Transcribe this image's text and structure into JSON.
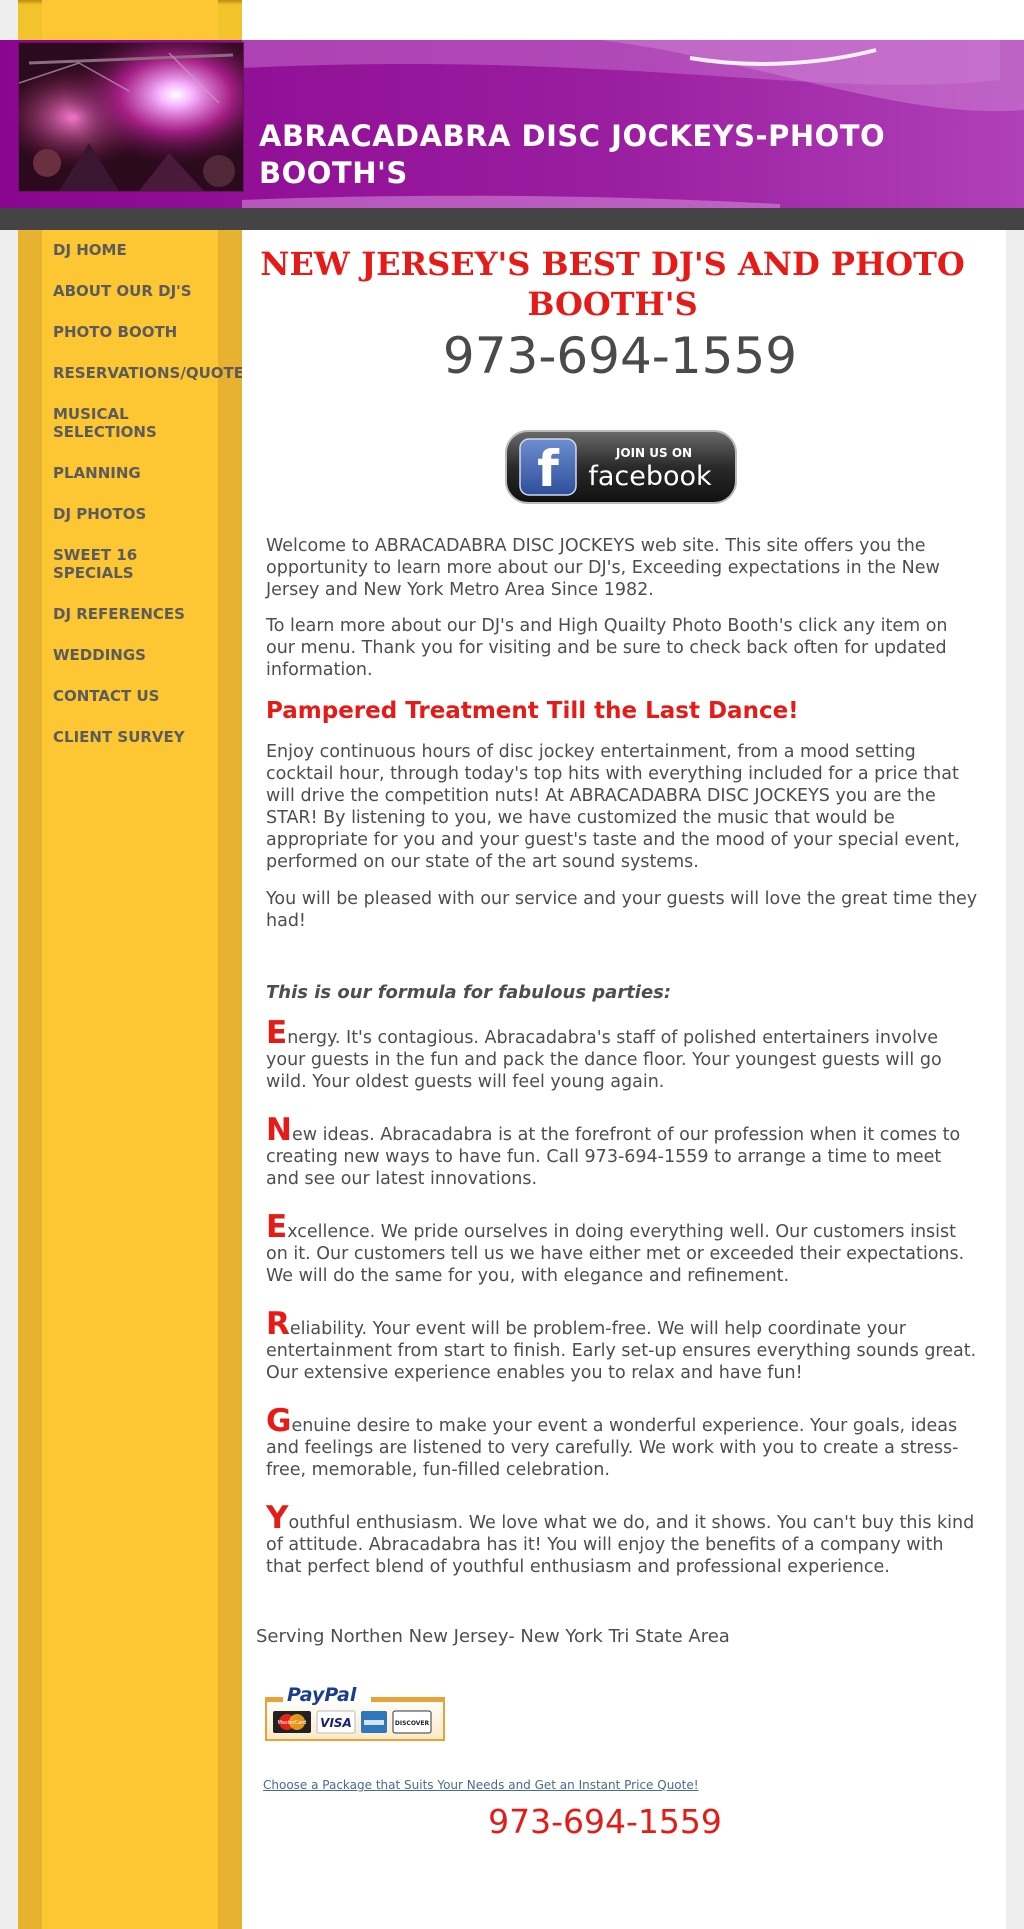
{
  "header": {
    "title": "ABRACADABRA DISC JOCKEYS-PHOTO BOOTH'S"
  },
  "sidebar": {
    "items": [
      {
        "label": "DJ HOME"
      },
      {
        "label": "ABOUT OUR DJ'S"
      },
      {
        "label": "PHOTO BOOTH"
      },
      {
        "label": "RESERVATIONS/QUOTE"
      },
      {
        "label": "MUSICAL SELECTIONS"
      },
      {
        "label": "PLANNING"
      },
      {
        "label": "DJ PHOTOS"
      },
      {
        "label": "SWEET 16 SPECIALS"
      },
      {
        "label": "DJ REFERENCES"
      },
      {
        "label": "WEDDINGS"
      },
      {
        "label": "CONTACT US"
      },
      {
        "label": "CLIENT SURVEY"
      }
    ]
  },
  "main": {
    "heading": "NEW JERSEY'S BEST DJ'S AND PHOTO BOOTH'S",
    "phone": "973-694-1559",
    "facebook": {
      "line1": "JOIN US ON",
      "line2": "facebook",
      "logo_letter": "f"
    },
    "intro": [
      "Welcome to ABRACADABRA DISC JOCKEYS web site.  This site offers you the opportunity to learn more about our DJ's, Exceeding expectations in the New Jersey and New York Metro Area Since 1982.",
      "To learn more about our DJ's and High Quailty Photo Booth's click any item on our menu.  Thank you for visiting and be sure to check back often for updated information."
    ],
    "sub_heading": "Pampered Treatment Till the Last Dance!",
    "body": [
      "Enjoy continuous hours of disc jockey entertainment, from a mood setting cocktail hour, through today's top hits with everything included for a price that will drive the competition nuts!  At ABRACADABRA DISC JOCKEYS you are the STAR!  By listening to you, we have customized the music that would be appropriate for you and your guest's taste and the mood of your special event, performed on our state of the art sound systems.",
      "You will be pleased with our service and your guests will love the great time they had!"
    ],
    "formula_title": "This is our formula for fabulous parties:",
    "formula": [
      {
        "letter": "E",
        "text": "nergy.  It's contagious.  Abracadabra's staff of polished entertainers involve your guests in the fun and pack the dance floor.  Your youngest guests will go wild.  Your oldest guests will feel young again."
      },
      {
        "letter": "N",
        "text": "ew ideas.  Abracadabra is at the forefront of our profession when it comes to creating new ways to have fun.  Call 973-694-1559 to arrange a time to meet and see our latest innovations."
      },
      {
        "letter": "E",
        "text": "xcellence.  We pride ourselves in doing everything well.  Our customers insist on it.  Our customers tell us we have either met or exceeded their expectations.  We will do the same for you, with elegance and refinement."
      },
      {
        "letter": "R",
        "text": "eliability.  Your event will be problem-free.  We will help coordinate your entertainment from start to finish.  Early set-up ensures everything sounds great.  Our extensive experience enables you to relax and have fun!"
      },
      {
        "letter": "G",
        "text": "enuine desire to make your event a wonderful experience.  Your goals, ideas and feelings are listened to very carefully.  We work with you to create a stress-free, memorable, fun-filled celebration."
      },
      {
        "letter": "Y",
        "text": "outhful enthusiasm.  We love what we do, and it shows.  You can't buy this kind of attitude.  Abracadabra has it!  You will enjoy the benefits of a company with that perfect blend of youthful enthusiasm and professional experience."
      }
    ],
    "serving": "Serving Northen New Jersey- New York Tri State Area",
    "paypal": {
      "brand": "PayPal",
      "cards": [
        "MasterCard",
        "VISA",
        "",
        "DISCOVER"
      ]
    },
    "quote_link": "Choose a Package that Suits Your Needs and Get an Instant Price Quote!",
    "phone_footer": "973-694-1559"
  },
  "colors": {
    "banner_purple": "#8f0893",
    "accent_red": "#e41b17",
    "sidebar_yellow": "#fcc733",
    "sidebar_edge": "#e6b22f",
    "body_text": "#4e4e4e"
  }
}
